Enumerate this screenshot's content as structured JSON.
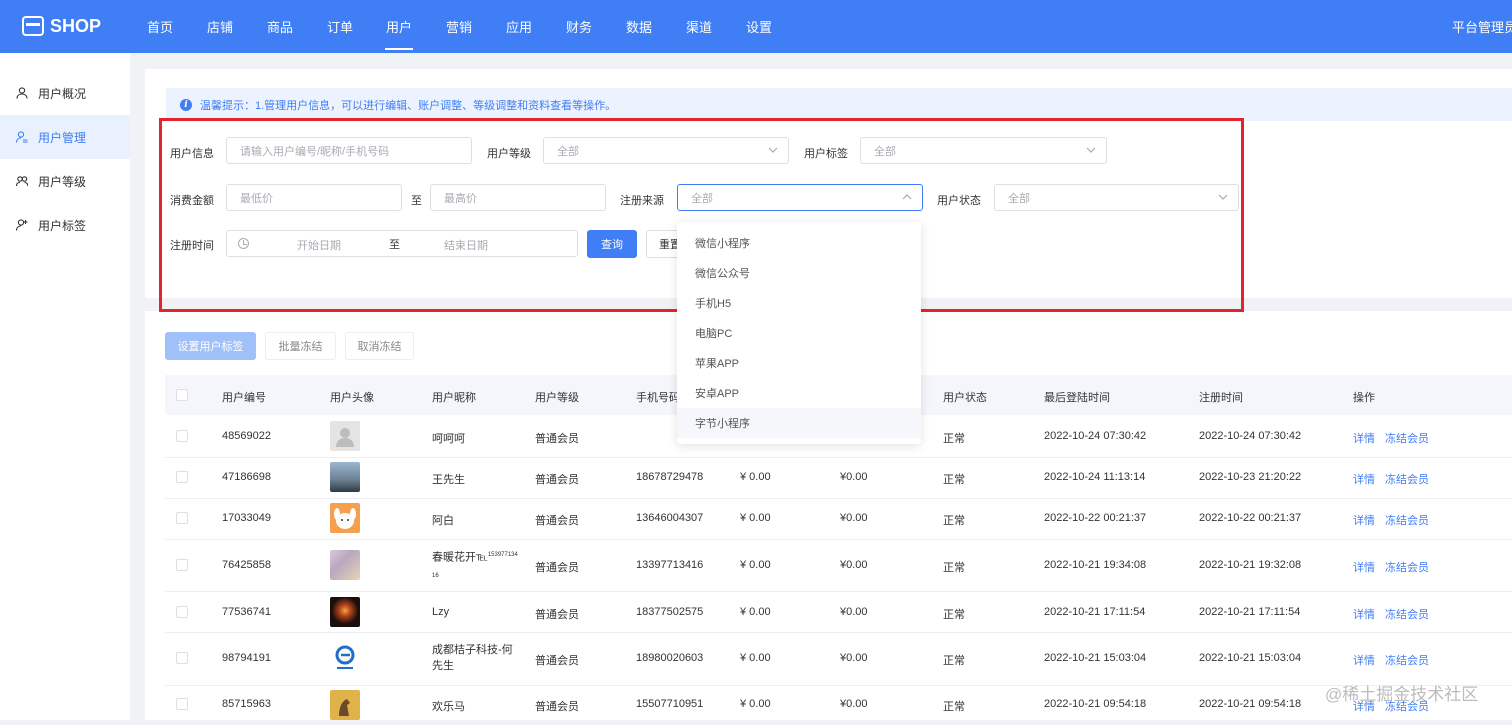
{
  "brand": {
    "name": "SHOP"
  },
  "nav": [
    {
      "label": "首页"
    },
    {
      "label": "店铺"
    },
    {
      "label": "商品"
    },
    {
      "label": "订单"
    },
    {
      "label": "用户"
    },
    {
      "label": "营销"
    },
    {
      "label": "应用"
    },
    {
      "label": "财务"
    },
    {
      "label": "数据"
    },
    {
      "label": "渠道"
    },
    {
      "label": "设置"
    }
  ],
  "nav_active": "用户",
  "user": {
    "label": "平台管理员"
  },
  "sidebar": {
    "items": [
      {
        "label": "用户概况",
        "icon": "user-icon"
      },
      {
        "label": "用户管理",
        "icon": "user-manage-icon"
      },
      {
        "label": "用户等级",
        "icon": "user-group-icon"
      },
      {
        "label": "用户标签",
        "icon": "user-tag-icon"
      }
    ],
    "active": "用户管理"
  },
  "tip": {
    "text": "温馨提示：1.管理用户信息，可以进行编辑、账户调整、等级调整和资料查看等操作。"
  },
  "filters": {
    "user_info": {
      "label": "用户信息",
      "placeholder": "请输入用户编号/昵称/手机号码"
    },
    "user_level": {
      "label": "用户等级",
      "value": "全部"
    },
    "user_tag": {
      "label": "用户标签",
      "value": "全部"
    },
    "spend": {
      "label": "消费金额",
      "min_placeholder": "最低价",
      "to": "至",
      "max_placeholder": "最高价"
    },
    "source": {
      "label": "注册来源",
      "value": "全部"
    },
    "status": {
      "label": "用户状态",
      "value": "全部"
    },
    "reg_time": {
      "label": "注册时间",
      "start_placeholder": "开始日期",
      "to": "至",
      "end_placeholder": "结束日期"
    },
    "query_label": "查询",
    "reset_label": "重置"
  },
  "source_options": [
    "微信小程序",
    "微信公众号",
    "手机H5",
    "电脑PC",
    "苹果APP",
    "安卓APP",
    "字节小程序"
  ],
  "actions": {
    "set_tag": "设置用户标签",
    "batch_freeze": "批量冻结",
    "unfreeze": "取消冻结"
  },
  "table": {
    "headers": {
      "id": "用户编号",
      "avatar": "用户头像",
      "nick": "用户昵称",
      "level": "用户等级",
      "phone": "手机号码",
      "status": "用户状态",
      "last_login": "最后登陆时间",
      "reg_time": "注册时间",
      "ops": "操作"
    },
    "rows": [
      {
        "id": "48569022",
        "nick": "呵呵呵",
        "level": "普通会员",
        "phone": "",
        "bal": "",
        "spent": "",
        "status": "正常",
        "last": "2022-10-24 07:30:42",
        "reg": "2022-10-24 07:30:42",
        "detail": "详情",
        "freeze": "冻结会员"
      },
      {
        "id": "47186698",
        "nick": "王先生",
        "level": "普通会员",
        "phone": "18678729478",
        "bal": "¥ 0.00",
        "spent": "¥0.00",
        "status": "正常",
        "last": "2022-10-24 11:13:14",
        "reg": "2022-10-23 21:20:22",
        "detail": "详情",
        "freeze": "冻结会员"
      },
      {
        "id": "17033049",
        "nick": "阿白",
        "level": "普通会员",
        "phone": "13646004307",
        "bal": "¥ 0.00",
        "spent": "¥0.00",
        "status": "正常",
        "last": "2022-10-22 00:21:37",
        "reg": "2022-10-22 00:21:37",
        "detail": "详情",
        "freeze": "冻结会员"
      },
      {
        "id": "76425858",
        "nick": "春暖花开℡",
        "nick_sup": "153977134",
        "nick_line2": "16",
        "level": "普通会员",
        "phone": "13397713416",
        "bal": "¥ 0.00",
        "spent": "¥0.00",
        "status": "正常",
        "last": "2022-10-21 19:34:08",
        "reg": "2022-10-21 19:32:08",
        "detail": "详情",
        "freeze": "冻结会员"
      },
      {
        "id": "77536741",
        "nick": "Lzy",
        "level": "普通会员",
        "phone": "18377502575",
        "bal": "¥ 0.00",
        "spent": "¥0.00",
        "status": "正常",
        "last": "2022-10-21 17:11:54",
        "reg": "2022-10-21 17:11:54",
        "detail": "详情",
        "freeze": "冻结会员"
      },
      {
        "id": "98794191",
        "nick": "成都桔子科技-何",
        "nick_line2": "先生",
        "level": "普通会员",
        "phone": "18980020603",
        "bal": "¥ 0.00",
        "spent": "¥0.00",
        "status": "正常",
        "last": "2022-10-21 15:03:04",
        "reg": "2022-10-21 15:03:04",
        "detail": "详情",
        "freeze": "冻结会员"
      },
      {
        "id": "85715963",
        "nick": "欢乐马",
        "level": "普通会员",
        "phone": "15507710951",
        "bal": "¥ 0.00",
        "spent": "¥0.00",
        "status": "正常",
        "last": "2022-10-21 09:54:18",
        "reg": "2022-10-21 09:54:18",
        "detail": "详情",
        "freeze": "冻结会员"
      }
    ]
  },
  "watermark": "@稀土掘金技术社区",
  "colors": {
    "primary": "#3f7ef5",
    "highlight": "#e0262c",
    "tip_bg": "#ecf3fe"
  }
}
